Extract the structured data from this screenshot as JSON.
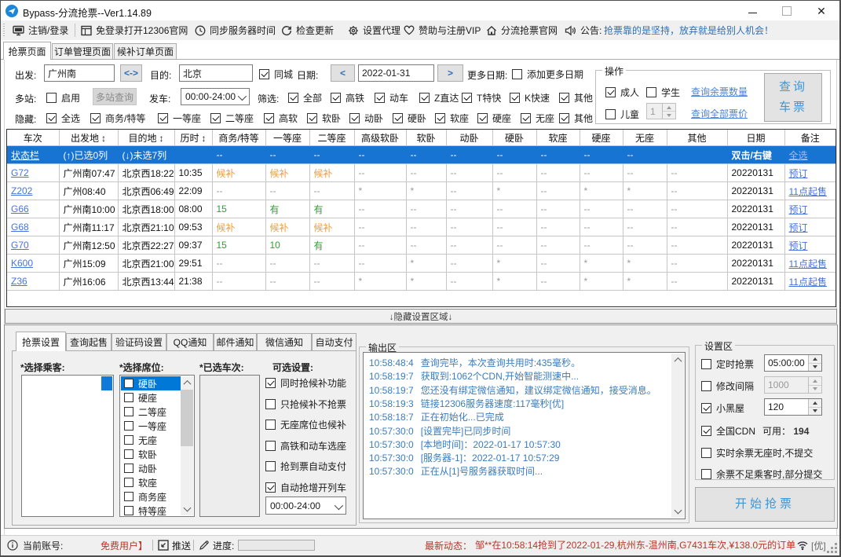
{
  "window": {
    "title": "Bypass-分流抢票--Ver1.14.89",
    "controls": {
      "minimize": "–",
      "maximize": "□",
      "close": "✕"
    }
  },
  "toolbar": {
    "items": [
      {
        "icon": "logout-monitor-icon",
        "label": "注销/登录"
      },
      {
        "icon": "window-icon",
        "label": "免登录打开12306官网"
      },
      {
        "icon": "clock-icon",
        "label": "同步服务器时间"
      },
      {
        "icon": "refresh-icon",
        "label": "检查更新"
      },
      {
        "icon": "gear-icon",
        "label": "设置代理"
      },
      {
        "icon": "heart-icon",
        "label": "赞助与注册VIP"
      },
      {
        "icon": "home-icon",
        "label": "分流抢票官网"
      },
      {
        "icon": "speaker-icon",
        "label": "公告:"
      }
    ],
    "announcement": "抢票靠的是坚持，放弃就是给别人机会！"
  },
  "main_tabs": [
    {
      "label": "抢票页面",
      "active": true
    },
    {
      "label": "订单管理页面",
      "active": false
    },
    {
      "label": "候补订单页面",
      "active": false
    }
  ],
  "query_form": {
    "depart_label": "出发:",
    "depart_value": "广州南",
    "swap_label": "<->",
    "dest_label": "目的:",
    "dest_value": "北京",
    "same_city": {
      "label": "同城",
      "checked": true
    },
    "date_label": "日期:",
    "date_prev": "<",
    "date_value": "2022-01-31",
    "date_next": ">",
    "more_date_label": "更多日期:",
    "add_more_dates": {
      "label": "添加更多日期",
      "checked": false
    },
    "multi_label": "多站:",
    "multi_enable": {
      "label": "启用",
      "checked": false
    },
    "multi_query_button": "多站查询",
    "depart_time_label": "发车:",
    "depart_time_value": "00:00-24:00",
    "filter_label": "筛选:",
    "filters": [
      {
        "label": "全部",
        "checked": true
      },
      {
        "label": "高铁",
        "checked": true
      },
      {
        "label": "动车",
        "checked": true
      },
      {
        "label": "Z直达",
        "checked": true
      },
      {
        "label": "T特快",
        "checked": true
      },
      {
        "label": "K快速",
        "checked": true
      },
      {
        "label": "其他",
        "checked": true
      }
    ],
    "hide_label": "隐藏:",
    "hide_items": [
      {
        "label": "全选",
        "checked": true
      },
      {
        "label": "商务/特等",
        "checked": true
      },
      {
        "label": "一等座",
        "checked": true
      },
      {
        "label": "二等座",
        "checked": true
      },
      {
        "label": "高软",
        "checked": true
      },
      {
        "label": "软卧",
        "checked": true
      },
      {
        "label": "动卧",
        "checked": true
      },
      {
        "label": "硬卧",
        "checked": true
      },
      {
        "label": "软座",
        "checked": true
      },
      {
        "label": "硬座",
        "checked": true
      },
      {
        "label": "无座",
        "checked": true
      },
      {
        "label": "其他",
        "checked": true
      }
    ]
  },
  "operation_box": {
    "title": "操作",
    "adult": {
      "label": "成人",
      "checked": true
    },
    "student": {
      "label": "学生",
      "checked": false
    },
    "child": {
      "label": "儿童",
      "checked": false
    },
    "child_count": "1",
    "link_remaining": "查询余票数量",
    "link_prices": "查询全部票价",
    "query_button_line1": "查询",
    "query_button_line2": "车票"
  },
  "train_table": {
    "columns": [
      {
        "label": "车次",
        "sort": false
      },
      {
        "label": "出发地",
        "sort": true
      },
      {
        "label": "目的地",
        "sort": true
      },
      {
        "label": "历时",
        "sort": true
      },
      {
        "label": "商务/特等",
        "sort": false
      },
      {
        "label": "一等座",
        "sort": false
      },
      {
        "label": "二等座",
        "sort": false
      },
      {
        "label": "高级软卧",
        "sort": false
      },
      {
        "label": "软卧",
        "sort": false
      },
      {
        "label": "动卧",
        "sort": false
      },
      {
        "label": "硬卧",
        "sort": false
      },
      {
        "label": "软座",
        "sort": false
      },
      {
        "label": "硬座",
        "sort": false
      },
      {
        "label": "无座",
        "sort": false
      },
      {
        "label": "其他",
        "sort": false
      },
      {
        "label": "日期",
        "sort": false
      },
      {
        "label": "备注",
        "sort": false
      }
    ],
    "status_row": {
      "train": "状态栏",
      "from": "(↑)已选0列",
      "to": "(↓)未选7列",
      "duration": "",
      "seats": [
        "--",
        "--",
        "--",
        "--",
        "--",
        "--",
        "--",
        "--",
        "--",
        "--",
        ""
      ],
      "date": "双击/右键",
      "action": "全选"
    },
    "rows": [
      {
        "train": "G72",
        "from": "广州南07:47",
        "to": "北京西18:22",
        "duration": "10:35",
        "seats": [
          "候补",
          "候补",
          "候补",
          "--",
          "--",
          "--",
          "--",
          "--",
          "--",
          "--",
          "--"
        ],
        "date": "20220131",
        "action": "预订"
      },
      {
        "train": "Z202",
        "from": "广州08:40",
        "to": "北京西06:49",
        "duration": "22:09",
        "seats": [
          "--",
          "--",
          "--",
          "*",
          "*",
          "--",
          "*",
          "--",
          "*",
          "*",
          "--"
        ],
        "date": "20220131",
        "action": "11点起售"
      },
      {
        "train": "G66",
        "from": "广州南10:00",
        "to": "北京西18:00",
        "duration": "08:00",
        "seats": [
          "15",
          "有",
          "有",
          "--",
          "--",
          "--",
          "--",
          "--",
          "--",
          "--",
          "--"
        ],
        "date": "20220131",
        "action": "预订"
      },
      {
        "train": "G68",
        "from": "广州南11:17",
        "to": "北京西21:10",
        "duration": "09:53",
        "seats": [
          "候补",
          "候补",
          "候补",
          "--",
          "--",
          "--",
          "--",
          "--",
          "--",
          "--",
          "--"
        ],
        "date": "20220131",
        "action": "预订"
      },
      {
        "train": "G70",
        "from": "广州南12:50",
        "to": "北京西22:27",
        "duration": "09:37",
        "seats": [
          "15",
          "10",
          "有",
          "--",
          "--",
          "--",
          "--",
          "--",
          "--",
          "--",
          "--"
        ],
        "date": "20220131",
        "action": "预订"
      },
      {
        "train": "K600",
        "from": "广州15:09",
        "to": "北京西21:00",
        "duration": "29:51",
        "seats": [
          "--",
          "--",
          "--",
          "--",
          "*",
          "--",
          "*",
          "--",
          "*",
          "*",
          "--"
        ],
        "date": "20220131",
        "action": "11点起售"
      },
      {
        "train": "Z36",
        "from": "广州16:06",
        "to": "北京西13:44",
        "duration": "21:38",
        "seats": [
          "--",
          "--",
          "--",
          "*",
          "*",
          "--",
          "*",
          "--",
          "*",
          "*",
          "--"
        ],
        "date": "20220131",
        "action": "11点起售"
      }
    ]
  },
  "divider_label": "↓隐藏设置区域↓",
  "settings_tabs": [
    {
      "label": "抢票设置",
      "active": true
    },
    {
      "label": "查询起售",
      "active": false
    },
    {
      "label": "验证码设置",
      "active": false
    },
    {
      "label": "QQ通知",
      "active": false
    },
    {
      "label": "邮件通知",
      "active": false
    },
    {
      "label": "微信通知",
      "active": false
    },
    {
      "label": "自动支付",
      "active": false
    }
  ],
  "grab_settings": {
    "passenger_label": "*选择乘客:",
    "seat_label": "*选择席位:",
    "train_label": "*已选车次:",
    "options_label": "可选设置:",
    "seats": [
      {
        "label": "硬卧",
        "checked": false,
        "selected": true
      },
      {
        "label": "硬座",
        "checked": false,
        "selected": false
      },
      {
        "label": "二等座",
        "checked": false,
        "selected": false
      },
      {
        "label": "一等座",
        "checked": false,
        "selected": false
      },
      {
        "label": "无座",
        "checked": false,
        "selected": false
      },
      {
        "label": "软卧",
        "checked": false,
        "selected": false
      },
      {
        "label": "动卧",
        "checked": false,
        "selected": false
      },
      {
        "label": "软座",
        "checked": false,
        "selected": false
      },
      {
        "label": "商务座",
        "checked": false,
        "selected": false
      },
      {
        "label": "特等座",
        "checked": false,
        "selected": false
      }
    ],
    "options": [
      {
        "label": "同时抢候补功能",
        "checked": true
      },
      {
        "label": "只抢候补不抢票",
        "checked": false
      },
      {
        "label": "无座席位也候补",
        "checked": false
      },
      {
        "label": "高铁和动车选座",
        "checked": false
      },
      {
        "label": "抢到票自动支付",
        "checked": false
      },
      {
        "label": "自动抢增开列车",
        "checked": true
      }
    ],
    "time_range_value": "00:00-24:00"
  },
  "output_box": {
    "title": "输出区",
    "lines": [
      {
        "time": "10:58:48:4",
        "text": "查询完毕，本次查询共用时:435毫秒。"
      },
      {
        "time": "10:58:19:7",
        "text": "获取到:1062个CDN,开始智能测速中..."
      },
      {
        "time": "10:58:19:7",
        "text": "您还没有绑定微信通知，建议绑定微信通知，接受消息。"
      },
      {
        "time": "10:58:19:3",
        "text": "链接12306服务器速度:117毫秒[优]"
      },
      {
        "time": "10:58:18:7",
        "text": "正在初始化...已完成"
      },
      {
        "time": "10:57:30:0",
        "text": "[设置完毕]已同步时间"
      },
      {
        "time": "10:57:30:0",
        "text": "[本地时间]：2022-01-17 10:57:30"
      },
      {
        "time": "10:57:30:0",
        "text": "[服务器-1]：2022-01-17 10:57:29"
      },
      {
        "time": "10:57:30:0",
        "text": "正在从[1]号服务器获取时间..."
      }
    ]
  },
  "settings_box": {
    "title": "设置区",
    "timed_grab": {
      "label": "定时抢票",
      "checked": false,
      "value": "05:00:00",
      "disabled": false
    },
    "interval": {
      "label": "修改间隔",
      "checked": false,
      "value": "1000",
      "disabled": true
    },
    "blackroom": {
      "label": "小黑屋",
      "checked": true,
      "value": "120",
      "disabled": false
    },
    "cdn": {
      "label": "全国CDN",
      "checked": true,
      "avail_label": "可用：",
      "avail_value": "194"
    },
    "no_seat": {
      "label": "实时余票无座时,不提交",
      "checked": false
    },
    "partial": {
      "label": "余票不足乘客时,部分提交",
      "checked": false
    },
    "start_button": "开始抢票"
  },
  "status_bar": {
    "account_label": "当前账号:",
    "account_value": "免费用户】",
    "push_label": "推送",
    "progress_label": "进度:",
    "latest_label": "最新动态：",
    "latest_text": "邹**在10:58:14抢到了2022-01-29,杭州东-温州南,G7431车次,¥138.0元的订单",
    "quality_badge": "[优]"
  }
}
